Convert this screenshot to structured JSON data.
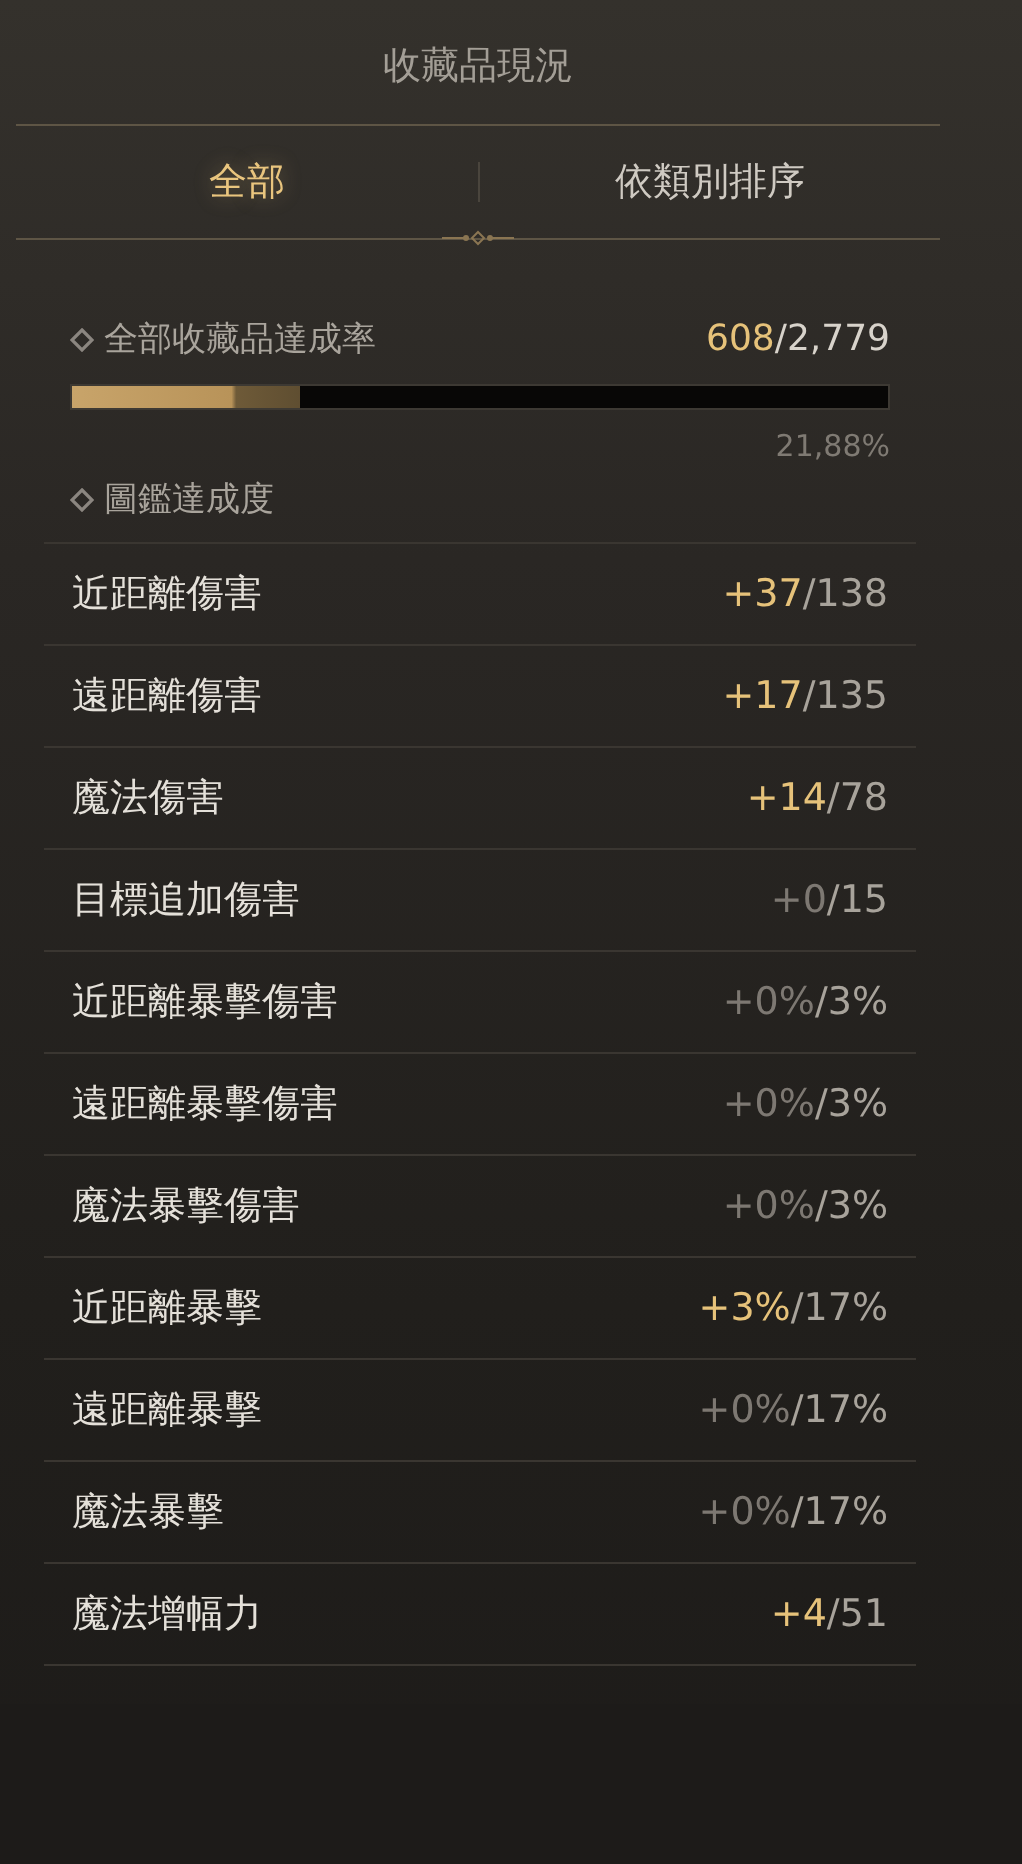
{
  "title": "收藏品現況",
  "tabs": [
    {
      "label": "全部",
      "selected": true
    },
    {
      "label": "依類別排序",
      "selected": false
    }
  ],
  "summary": {
    "label": "全部收藏品達成率",
    "current": "608",
    "total": "/2,779",
    "level": 0.28,
    "percent": "21,88%"
  },
  "section": {
    "label": "圖鑑達成度"
  },
  "stats": [
    {
      "name": "近距離傷害",
      "gain": "+37",
      "max": "/138",
      "active": true
    },
    {
      "name": "遠距離傷害",
      "gain": "+17",
      "max": "/135",
      "active": true
    },
    {
      "name": "魔法傷害",
      "gain": "+14",
      "max": "/78",
      "active": true
    },
    {
      "name": "目標追加傷害",
      "gain": "+0",
      "max": "/15",
      "active": false
    },
    {
      "name": "近距離暴擊傷害",
      "gain": "+0%",
      "max": "/3%",
      "active": false
    },
    {
      "name": "遠距離暴擊傷害",
      "gain": "+0%",
      "max": "/3%",
      "active": false
    },
    {
      "name": "魔法暴擊傷害",
      "gain": "+0%",
      "max": "/3%",
      "active": false
    },
    {
      "name": "近距離暴擊",
      "gain": "+3%",
      "max": "/17%",
      "active": true
    },
    {
      "name": "遠距離暴擊",
      "gain": "+0%",
      "max": "/17%",
      "active": false
    },
    {
      "name": "魔法暴擊",
      "gain": "+0%",
      "max": "/17%",
      "active": false
    },
    {
      "name": "魔法增幅力",
      "gain": "+4",
      "max": "/51",
      "active": true
    }
  ]
}
